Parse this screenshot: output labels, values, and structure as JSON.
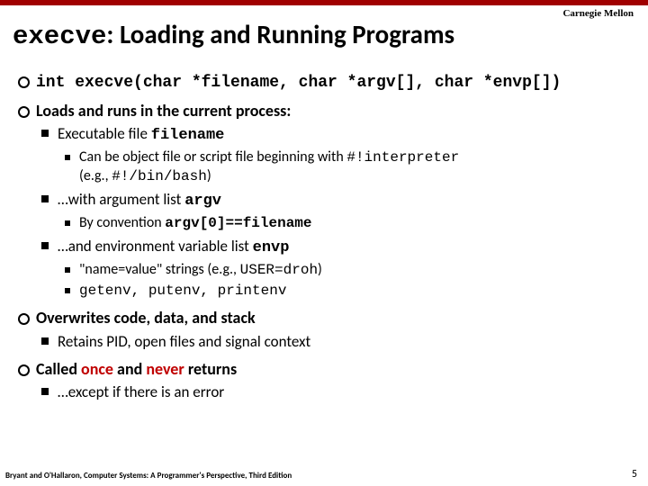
{
  "header": {
    "institution": "Carnegie Mellon",
    "title_code": "execve",
    "title_rest": ": Loading and Running Programs"
  },
  "b1": {
    "signature": "int execve(char *filename, char *argv[], char *envp[])"
  },
  "b2": {
    "text": "Loads and runs in the current process:",
    "s1": {
      "prefix": "Executable file ",
      "code": "filename",
      "sub1_a": "Can be object file or script file beginning with ",
      "sub1_code1": "#!interpreter",
      "sub1_b": "(e.g., ",
      "sub1_code2": "#!/bin/bash",
      "sub1_c": ")"
    },
    "s2": {
      "prefix": "…with argument list ",
      "code": "argv",
      "sub1_a": "By convention ",
      "sub1_code": "argv[0]==filename"
    },
    "s3": {
      "prefix": "…and  environment variable list  ",
      "code": "envp",
      "sub1_a": "\"name=value\" strings (e.g., ",
      "sub1_code": "USER=droh",
      "sub1_b": ")",
      "sub2": "getenv, putenv, printenv"
    }
  },
  "b3": {
    "text": "Overwrites code, data, and stack",
    "s1": "Retains PID, open files and signal context"
  },
  "b4": {
    "prefix": "Called ",
    "w1": "once",
    "mid": " and ",
    "w2": "never",
    "suffix": " returns",
    "s1": "…except if there is an error"
  },
  "footer": {
    "text": "Bryant and O'Hallaron, Computer Systems: A Programmer's Perspective, Third Edition",
    "page": "5"
  }
}
